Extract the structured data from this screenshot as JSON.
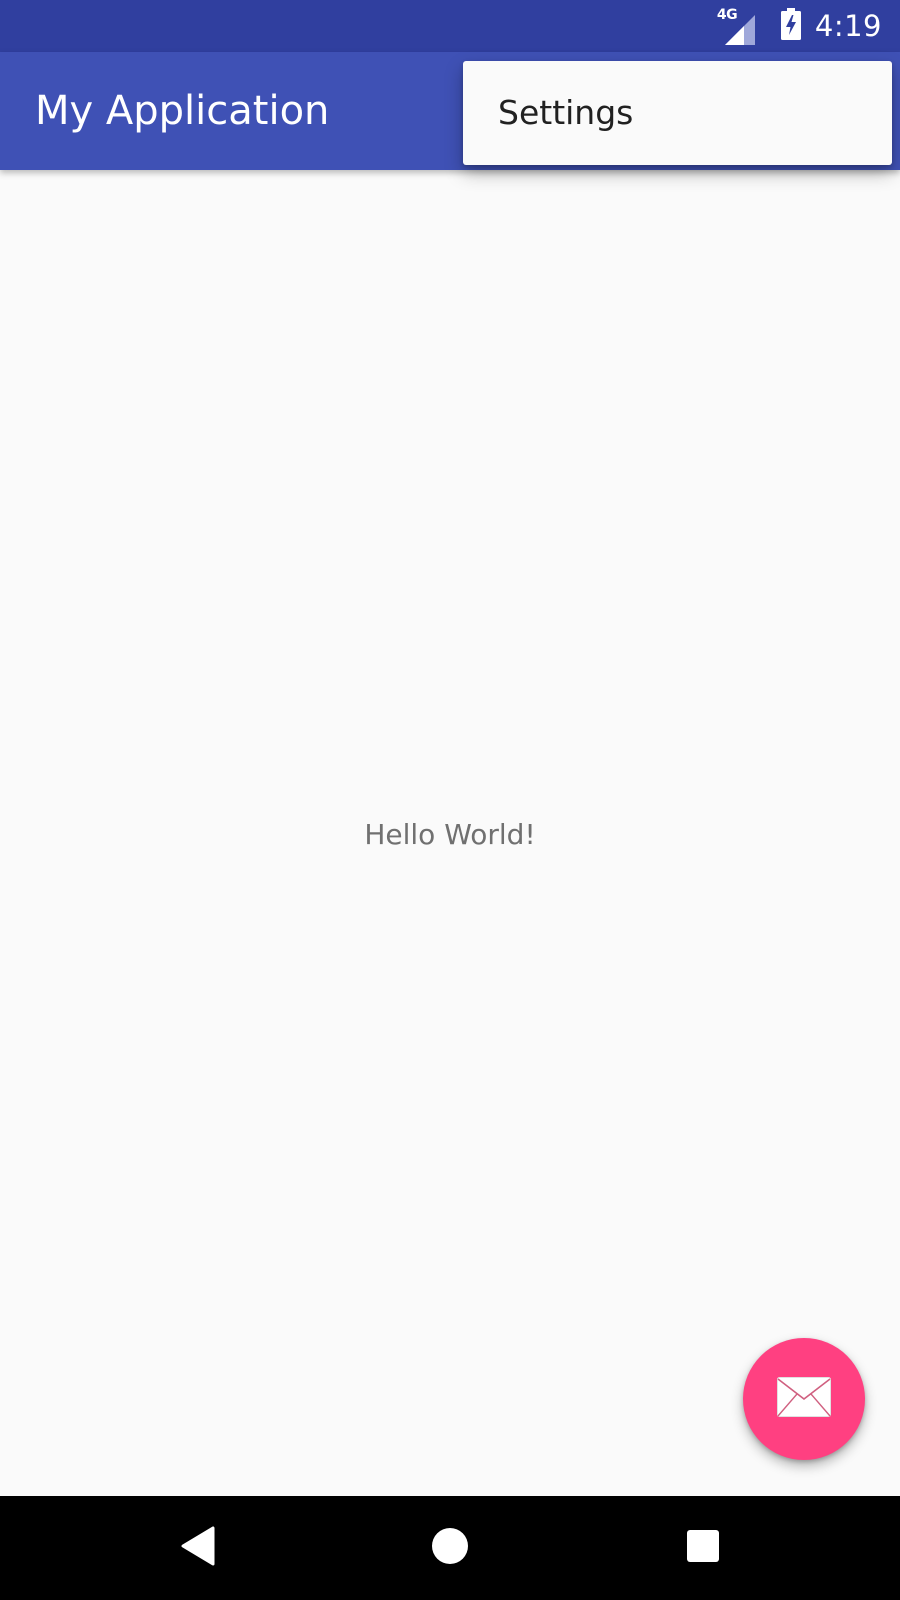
{
  "status_bar": {
    "network": "4G",
    "time": "4:19",
    "icons": [
      "signal-icon",
      "battery-charging-icon"
    ]
  },
  "app_bar": {
    "title": "My Application"
  },
  "overflow_menu": {
    "items": [
      {
        "label": "Settings"
      }
    ]
  },
  "content": {
    "message": "Hello World!"
  },
  "fab": {
    "icon": "mail-icon"
  },
  "nav_bar": {
    "icons": [
      "back-icon",
      "home-icon",
      "recents-icon"
    ]
  },
  "colors": {
    "primary": "#3F51B5",
    "primary_dark": "#303F9F",
    "accent": "#FF4081",
    "background": "#FAFAFA"
  }
}
